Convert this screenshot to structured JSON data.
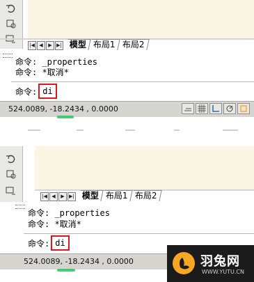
{
  "panels": [
    {
      "tabs": {
        "model": "模型",
        "layout1": "布局1",
        "layout2": "布局2"
      },
      "history": [
        "命令: _properties",
        "命令: *取消*"
      ],
      "prompt": "命令:",
      "input": "di",
      "coords": "524.0089, -18.2434 , 0.0000"
    },
    {
      "tabs": {
        "model": "模型",
        "layout1": "布局1",
        "layout2": "布局2"
      },
      "history": [
        "命令: _properties",
        "命令: *取消*"
      ],
      "prompt": "命令:",
      "input": "di",
      "coords": "524.0089, -18.2434 , 0.0000"
    }
  ],
  "watermark": {
    "name": "羽兔网",
    "url": "WWW.YUTU.CN"
  },
  "colors": {
    "highlight": "#e0151b",
    "canvas": "#fbf6e3",
    "status": "#d7d5cf"
  }
}
